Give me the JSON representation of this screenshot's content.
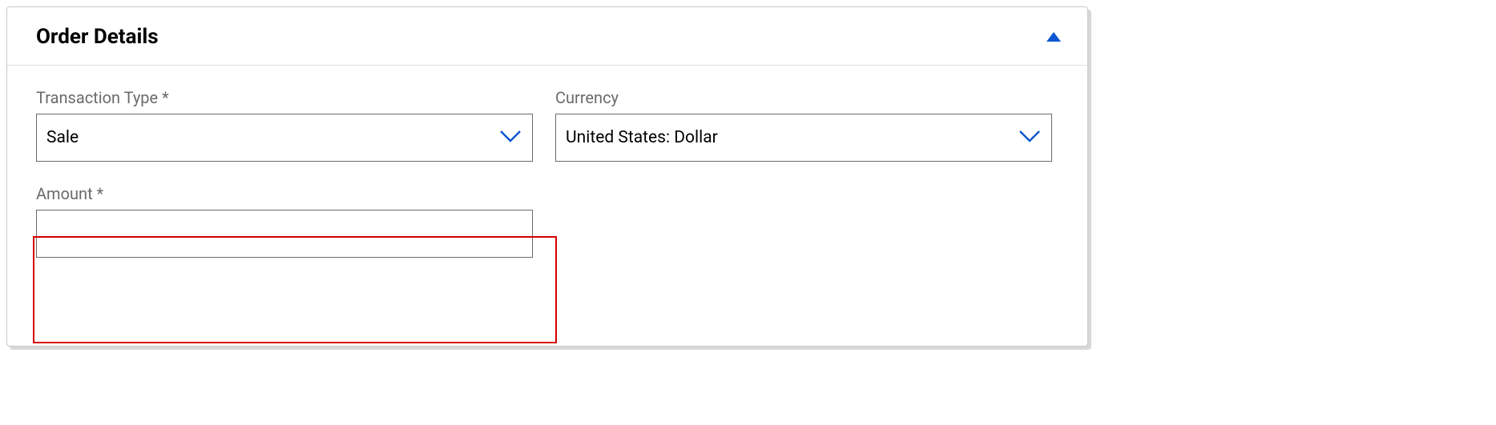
{
  "panel": {
    "title": "Order Details"
  },
  "fields": {
    "transaction_type": {
      "label": "Transaction Type *",
      "value": "Sale"
    },
    "currency": {
      "label": "Currency",
      "value": "United States: Dollar"
    },
    "amount": {
      "label": "Amount *",
      "value": ""
    }
  }
}
